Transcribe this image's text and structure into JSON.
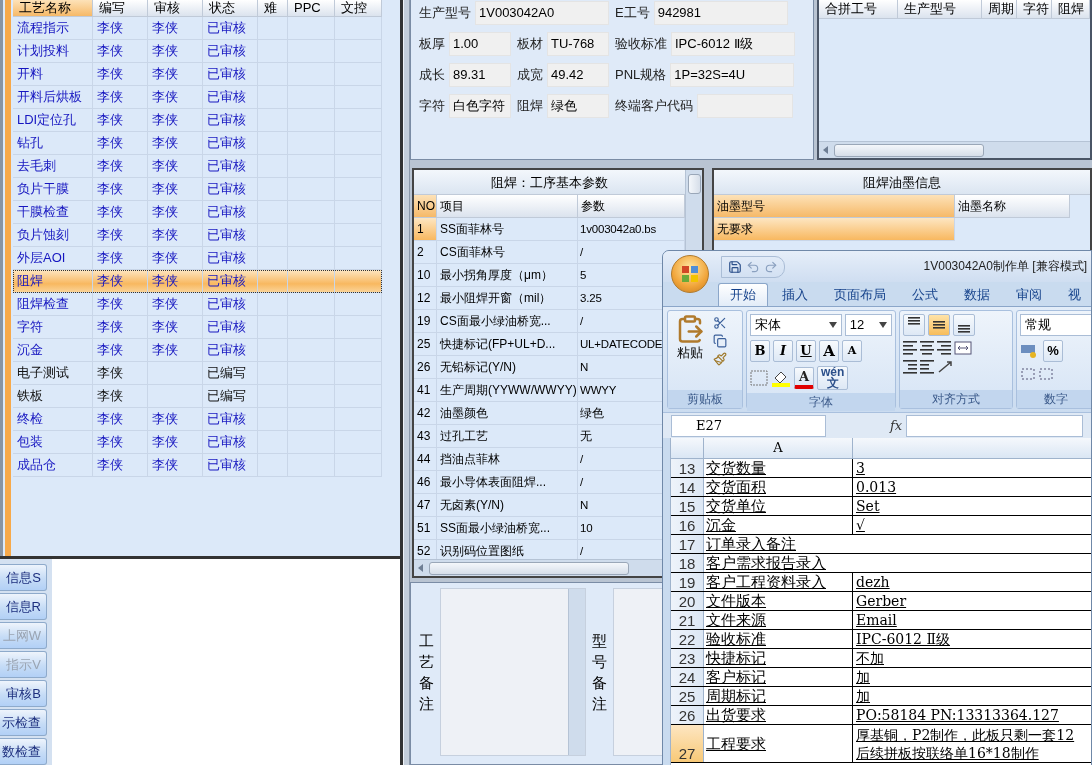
{
  "process_table": {
    "columns": [
      "工艺名称",
      "编写",
      "审核",
      "状态",
      "难",
      "PPC",
      "文控"
    ],
    "rows": [
      {
        "name": "流程指示",
        "writer": "李侠",
        "reviewer": "李侠",
        "status": "已审核",
        "reviewed": true,
        "selected": false
      },
      {
        "name": "计划投料",
        "writer": "李侠",
        "reviewer": "李侠",
        "status": "已审核",
        "reviewed": true,
        "selected": false
      },
      {
        "name": "开料",
        "writer": "李侠",
        "reviewer": "李侠",
        "status": "已审核",
        "reviewed": true,
        "selected": false
      },
      {
        "name": "开料后烘板",
        "writer": "李侠",
        "reviewer": "李侠",
        "status": "已审核",
        "reviewed": true,
        "selected": false
      },
      {
        "name": "LDI定位孔",
        "writer": "李侠",
        "reviewer": "李侠",
        "status": "已审核",
        "reviewed": true,
        "selected": false
      },
      {
        "name": "钻孔",
        "writer": "李侠",
        "reviewer": "李侠",
        "status": "已审核",
        "reviewed": true,
        "selected": false
      },
      {
        "name": "去毛刺",
        "writer": "李侠",
        "reviewer": "李侠",
        "status": "已审核",
        "reviewed": true,
        "selected": false
      },
      {
        "name": "负片干膜",
        "writer": "李侠",
        "reviewer": "李侠",
        "status": "已审核",
        "reviewed": true,
        "selected": false
      },
      {
        "name": "干膜检查",
        "writer": "李侠",
        "reviewer": "李侠",
        "status": "已审核",
        "reviewed": true,
        "selected": false
      },
      {
        "name": "负片蚀刻",
        "writer": "李侠",
        "reviewer": "李侠",
        "status": "已审核",
        "reviewed": true,
        "selected": false
      },
      {
        "name": "外层AOI",
        "writer": "李侠",
        "reviewer": "李侠",
        "status": "已审核",
        "reviewed": true,
        "selected": false
      },
      {
        "name": "阻焊",
        "writer": "李侠",
        "reviewer": "李侠",
        "status": "已审核",
        "reviewed": true,
        "selected": true
      },
      {
        "name": "阻焊检查",
        "writer": "李侠",
        "reviewer": "李侠",
        "status": "已审核",
        "reviewed": true,
        "selected": false
      },
      {
        "name": "字符",
        "writer": "李侠",
        "reviewer": "李侠",
        "status": "已审核",
        "reviewed": true,
        "selected": false
      },
      {
        "name": "沉金",
        "writer": "李侠",
        "reviewer": "李侠",
        "status": "已审核",
        "reviewed": true,
        "selected": false
      },
      {
        "name": "电子测试",
        "writer": "李侠",
        "status": "已编写",
        "reviewed": false,
        "selected": false
      },
      {
        "name": "铁板",
        "writer": "李侠",
        "status": "已编写",
        "reviewed": false,
        "selected": false
      },
      {
        "name": "终检",
        "writer": "李侠",
        "reviewer": "李侠",
        "status": "已审核",
        "reviewed": true,
        "selected": false
      },
      {
        "name": "包装",
        "writer": "李侠",
        "reviewer": "李侠",
        "status": "已审核",
        "reviewed": true,
        "selected": false
      },
      {
        "name": "成品仓",
        "writer": "李侠",
        "reviewer": "李侠",
        "status": "已审核",
        "reviewed": true,
        "selected": false
      }
    ]
  },
  "side_buttons": [
    {
      "label": "信息S",
      "disabled": false
    },
    {
      "label": "信息R",
      "disabled": false
    },
    {
      "label": "上网W",
      "disabled": true
    },
    {
      "label": "指示V",
      "disabled": true
    },
    {
      "label": "审核B",
      "disabled": false
    },
    {
      "label": "示检查",
      "disabled": false
    },
    {
      "label": "数检查",
      "disabled": false
    }
  ],
  "product_form": [
    [
      {
        "label": "生产型号",
        "value": "1V003042A0",
        "kind": "wide"
      },
      {
        "label": "E工号",
        "value": "942981",
        "kind": "wide"
      }
    ],
    [
      {
        "label": "板厚",
        "value": "1.00",
        "kind": "short"
      },
      {
        "label": "板材",
        "value": "TU-768",
        "kind": "short"
      },
      {
        "label": "验收标准",
        "value": "IPC-6012 Ⅱ级",
        "kind": "long"
      }
    ],
    [
      {
        "label": "成长",
        "value": "89.31",
        "kind": "short"
      },
      {
        "label": "成宽",
        "value": "49.42",
        "kind": "short"
      },
      {
        "label": "PNL规格",
        "value": "1P=32S=4U",
        "kind": "long"
      }
    ],
    [
      {
        "label": "字符",
        "value": "白色字符",
        "kind": "short"
      },
      {
        "label": "阻焊",
        "value": "绿色",
        "kind": "short"
      },
      {
        "label": "终端客户代码",
        "kind": "end"
      }
    ]
  ],
  "merge_table": {
    "columns": [
      "合拼工号",
      "生产型号",
      "周期",
      "字符",
      "阻焊"
    ]
  },
  "param_table": {
    "title": "阻焊：工序基本参数",
    "columns": [
      "NO",
      "项目",
      "参数"
    ],
    "rows": [
      {
        "no": "1",
        "item": "SS面菲林号",
        "value": "1v003042a0.bs",
        "selected": true
      },
      {
        "no": "2",
        "item": "CS面菲林号",
        "value": "/",
        "selected": false
      },
      {
        "no": "10",
        "item": "最小拐角厚度（μm）",
        "value": "5",
        "selected": false
      },
      {
        "no": "12",
        "item": "最小阻焊开窗（mil）",
        "value": "3.25",
        "selected": false
      },
      {
        "no": "19",
        "item": "CS面最小绿油桥宽...",
        "value": "/",
        "selected": false
      },
      {
        "no": "25",
        "item": "快捷标记(FP+UL+D...",
        "value": "UL+DATECODE",
        "selected": false
      },
      {
        "no": "26",
        "item": "无铅标记(Y/N)",
        "value": "N",
        "selected": false
      },
      {
        "no": "41",
        "item": "生产周期(YYWW/WWYY)",
        "value": "WWYY",
        "selected": false
      },
      {
        "no": "42",
        "item": "油墨颜色",
        "value": "绿色",
        "selected": false
      },
      {
        "no": "43",
        "item": "过孔工艺",
        "value": "无",
        "selected": false
      },
      {
        "no": "44",
        "item": "挡油点菲林",
        "value": "/",
        "selected": false
      },
      {
        "no": "46",
        "item": "最小导体表面阻焊...",
        "value": "/",
        "selected": false
      },
      {
        "no": "47",
        "item": "无卤素(Y/N)",
        "value": "N",
        "selected": false
      },
      {
        "no": "51",
        "item": "SS面最小绿油桥宽...",
        "value": "10",
        "selected": false
      },
      {
        "no": "52",
        "item": "识别码位置图纸",
        "value": "/",
        "selected": false
      }
    ]
  },
  "ink_table": {
    "title": "阻焊油墨信息",
    "columns": [
      "油墨型号",
      "油墨名称"
    ],
    "rows": [
      {
        "model": "无要求",
        "selected": true
      }
    ]
  },
  "remarks": [
    {
      "label": "工艺备注"
    },
    {
      "label": "型号备注"
    }
  ],
  "excel": {
    "title": "1V003042A0制作单  [兼容模式]",
    "tabs": [
      {
        "label": "开始",
        "selected": true
      },
      {
        "label": "插入",
        "selected": false
      },
      {
        "label": "页面布局",
        "selected": false
      },
      {
        "label": "公式",
        "selected": false
      },
      {
        "label": "数据",
        "selected": false
      },
      {
        "label": "审阅",
        "selected": false
      },
      {
        "label": "视",
        "selected": false
      }
    ],
    "paste_label": "粘贴",
    "font_name": "宋体",
    "font_size": "12",
    "format_buttons": [
      "B",
      "I",
      "U"
    ],
    "grow_letters": [
      "A",
      "A"
    ],
    "font_color_letter": "A",
    "phonetic": {
      "pinyin": "wén",
      "char": "文"
    },
    "vertical_align": [
      {
        "selected": false
      },
      {
        "selected": true
      },
      {
        "selected": false
      }
    ],
    "number_format": "常规",
    "percent": "%",
    "groups": [
      "剪贴板",
      "字体",
      "对齐方式",
      "数字"
    ],
    "name_box": "E27",
    "formula_label": "fx",
    "column_header": "A",
    "rows": [
      {
        "num": "13",
        "a": "交货数量",
        "b": "3",
        "selected": false
      },
      {
        "num": "14",
        "a": "交货面积",
        "b": "0.013",
        "selected": false
      },
      {
        "num": "15",
        "a": "交货单位",
        "b": "Set",
        "selected": false
      },
      {
        "num": "16",
        "a": "沉金",
        "b": "√",
        "selected": false
      },
      {
        "num": "17",
        "a": "订单录入备注",
        "selected": false
      },
      {
        "num": "18",
        "a": "客户需求报告录入",
        "selected": false
      },
      {
        "num": "19",
        "a": "客户工程资料录入",
        "b": "dezh",
        "selected": false
      },
      {
        "num": "20",
        "a": "文件版本",
        "b": "Gerber",
        "selected": false
      },
      {
        "num": "21",
        "a": "文件来源",
        "b": "Email",
        "selected": false
      },
      {
        "num": "22",
        "a": "验收标准",
        "b": "IPC-6012 Ⅱ级",
        "selected": false
      },
      {
        "num": "23",
        "a": "快捷标记",
        "b": "不加",
        "selected": false
      },
      {
        "num": "24",
        "a": "客户标记",
        "b": "加",
        "selected": false
      },
      {
        "num": "25",
        "a": "周期标记",
        "b": "加",
        "selected": false
      },
      {
        "num": "26",
        "a": "出货要求",
        "b": "PO:58184 PN:13313364.127",
        "selected": false
      },
      {
        "num": "27",
        "a": "工程要求",
        "b": "厚基铜，P2制作，此板只剩一套12\n后续拼板按联络单16*18制作",
        "selected": true
      }
    ]
  }
}
